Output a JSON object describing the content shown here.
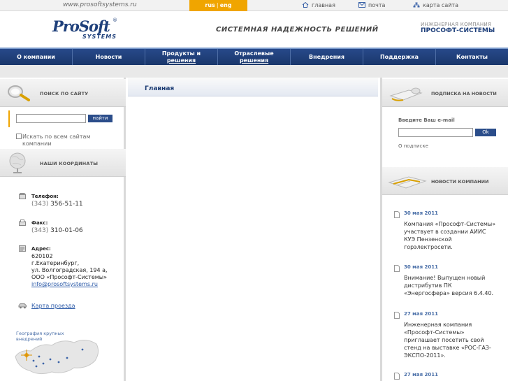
{
  "topbar": {
    "url": "www.prosoftsystems.ru",
    "lang_ru": "rus",
    "lang_sep": "|",
    "lang_en": "eng",
    "home": "главная",
    "mail": "почта",
    "sitemap": "карта сайта"
  },
  "header": {
    "logo_main": "ProSoft",
    "logo_sub": "SYSTEMS",
    "logo_reg": "®",
    "slogan": "СИСТЕМНАЯ НАДЕЖНОСТЬ РЕШЕНИЙ",
    "brand_line1": "ИНЖЕНЕРНАЯ КОМПАНИЯ",
    "brand_line2": "ПРОСОФТ-СИСТЕМЫ"
  },
  "nav": {
    "items": [
      {
        "l1": "О компании",
        "l2": ""
      },
      {
        "l1": "Новости",
        "l2": ""
      },
      {
        "l1": "Продукты и",
        "l2": "решения"
      },
      {
        "l1": "Отраслевые",
        "l2": "решения"
      },
      {
        "l1": "Внедрения",
        "l2": ""
      },
      {
        "l1": "Поддержка",
        "l2": ""
      },
      {
        "l1": "Контакты",
        "l2": ""
      }
    ]
  },
  "left": {
    "search_title": "ПОИСК ПО САЙТУ",
    "search_button": "найти",
    "search_all": "Искать по всем сайтам компании",
    "coords_title": "НАШИ КООРДИНАТЫ",
    "phone_label": "Телефон:",
    "phone_code": "(343)",
    "phone_number": "356-51-11",
    "fax_label": "Факс:",
    "fax_code": "(343)",
    "fax_number": "310-01-06",
    "addr_label": "Адрес:",
    "addr_zip": "620102",
    "addr_city": "г.Екатеринбург,",
    "addr_street": "ул. Волгоградская, 194 а,",
    "addr_company": "ООО «Прософт-Системы»",
    "addr_email": "info@prosoftsystems.ru",
    "map_link": "Карта проезда",
    "geo_label": "География крупных внедрений"
  },
  "center": {
    "title": "Главная"
  },
  "right": {
    "subscribe_title": "ПОДПИСКА НА НОВОСТИ",
    "email_label": "Введите Ваш e-mail",
    "ok_button": "Ok",
    "about_subscription": "О подписке",
    "news_title": "НОВОСТИ КОМПАНИИ",
    "news": [
      {
        "date": "30 мая 2011",
        "text": "Компания «Прософт-Системы» участвует в создании АИИС КУЭ Пензенской горэлектросети."
      },
      {
        "date": "30 мая 2011",
        "text": "Внимание! Выпущен новый дистрибутив ПК «Энергосфера» версия 6.4.40."
      },
      {
        "date": "27 мая 2011",
        "text": "Инженерная компания «Прософт-Системы» приглашает посетить свой стенд на выставке «РОС-ГАЗ-ЭКСПО-2011»."
      },
      {
        "date": "27 мая 2011",
        "text": ""
      }
    ]
  },
  "colors": {
    "nav": "#1c3c73",
    "accent": "#f0a500",
    "link": "#2b5aa8"
  }
}
